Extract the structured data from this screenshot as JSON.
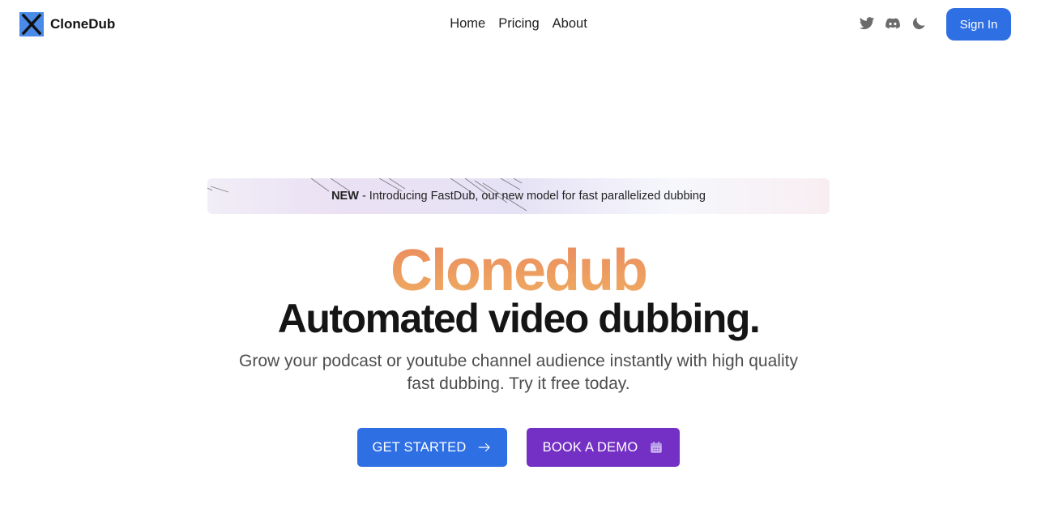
{
  "nav": {
    "brand": "CloneDub",
    "links": [
      "Home",
      "Pricing",
      "About"
    ],
    "icons": [
      "twitter-icon",
      "discord-icon",
      "moon-icon"
    ],
    "signin_label": "Sign In"
  },
  "banner": {
    "tag": "NEW",
    "text": " - Introducing FastDub, our new model for fast parallelized dubbing"
  },
  "hero": {
    "brand": "Clonedub",
    "title": "Automated video dubbing.",
    "subtitle_lines": [
      "Grow your podcast or youtube channel audience instantly with high quality",
      "fast dubbing. Try it free today."
    ]
  },
  "cta": {
    "primary_label": "GET STARTED",
    "primary_icon": "arrow-right-icon",
    "secondary_label": "BOOK A DEMO",
    "secondary_icon": "calendar-icon"
  },
  "colors": {
    "primary": "#2e6fe4",
    "secondary": "#7430c4",
    "brand_gradient_start": "#ea8a5f",
    "brand_gradient_end": "#f0ad62"
  }
}
